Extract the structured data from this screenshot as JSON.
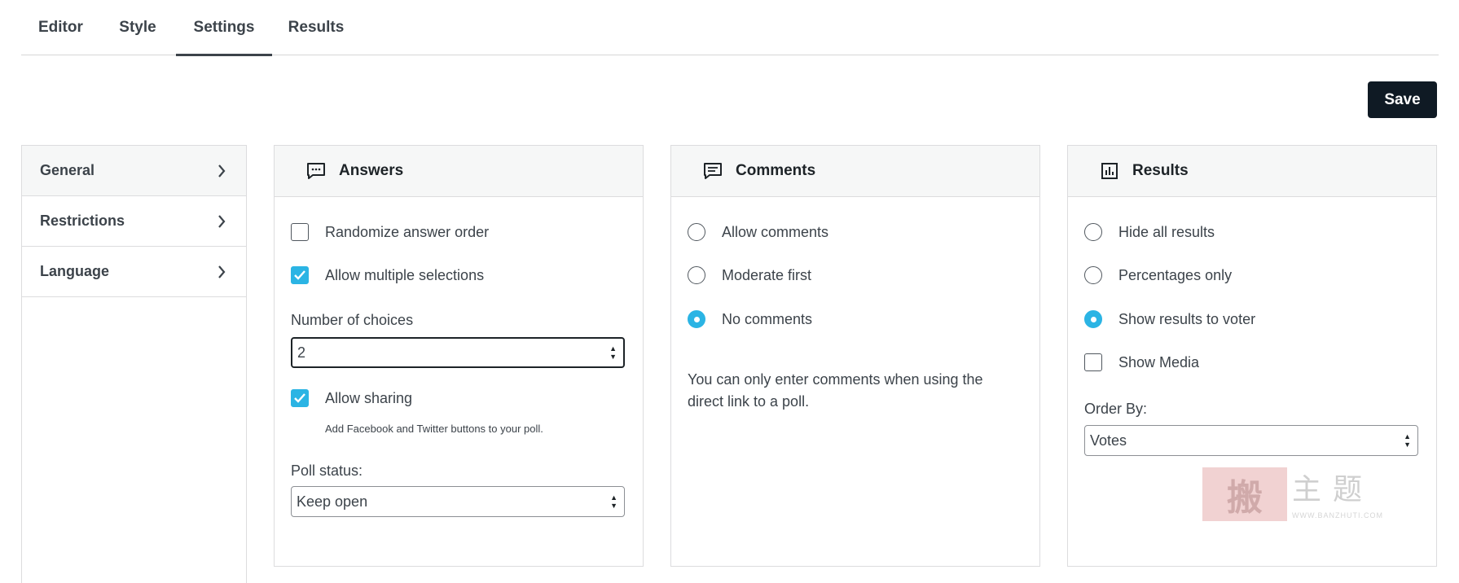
{
  "tabs": [
    {
      "label": "Editor",
      "active": false
    },
    {
      "label": "Style",
      "active": false
    },
    {
      "label": "Settings",
      "active": true
    },
    {
      "label": "Results",
      "active": false
    }
  ],
  "save_label": "Save",
  "sidebar": {
    "items": [
      {
        "label": "General",
        "icon": "chevron-right-icon"
      },
      {
        "label": "Restrictions",
        "icon": "chevron-right-icon"
      },
      {
        "label": "Language",
        "icon": "chevron-right-icon"
      }
    ]
  },
  "answers": {
    "title": "Answers",
    "icon": "chat-bubble-icon",
    "randomize_label": "Randomize answer order",
    "randomize_checked": false,
    "multiple_label": "Allow multiple selections",
    "multiple_checked": true,
    "choices_label": "Number of choices",
    "choices_value": "2",
    "sharing_label": "Allow sharing",
    "sharing_checked": true,
    "sharing_hint": "Add Facebook and Twitter buttons to your poll.",
    "status_label": "Poll status:",
    "status_value": "Keep open"
  },
  "comments": {
    "title": "Comments",
    "icon": "comment-icon",
    "options": [
      {
        "label": "Allow comments",
        "checked": false
      },
      {
        "label": "Moderate first",
        "checked": false
      },
      {
        "label": "No comments",
        "checked": true
      }
    ],
    "note": "You can only enter comments when using the direct link to a poll."
  },
  "results": {
    "title": "Results",
    "icon": "bar-chart-icon",
    "options": [
      {
        "label": "Hide all results",
        "checked": false
      },
      {
        "label": "Percentages only",
        "checked": false
      },
      {
        "label": "Show results to voter",
        "checked": true
      }
    ],
    "show_media_label": "Show Media",
    "show_media_checked": false,
    "order_label": "Order By:",
    "order_value": "Votes"
  },
  "watermark": {
    "stamp": "搬",
    "text": "主题",
    "url": "WWW.BANZHUTI.COM"
  },
  "colors": {
    "accent": "#2bb4e4",
    "save_bg": "#0f1a24",
    "panel_header_bg": "#f6f7f7",
    "border": "#dcdcde"
  }
}
